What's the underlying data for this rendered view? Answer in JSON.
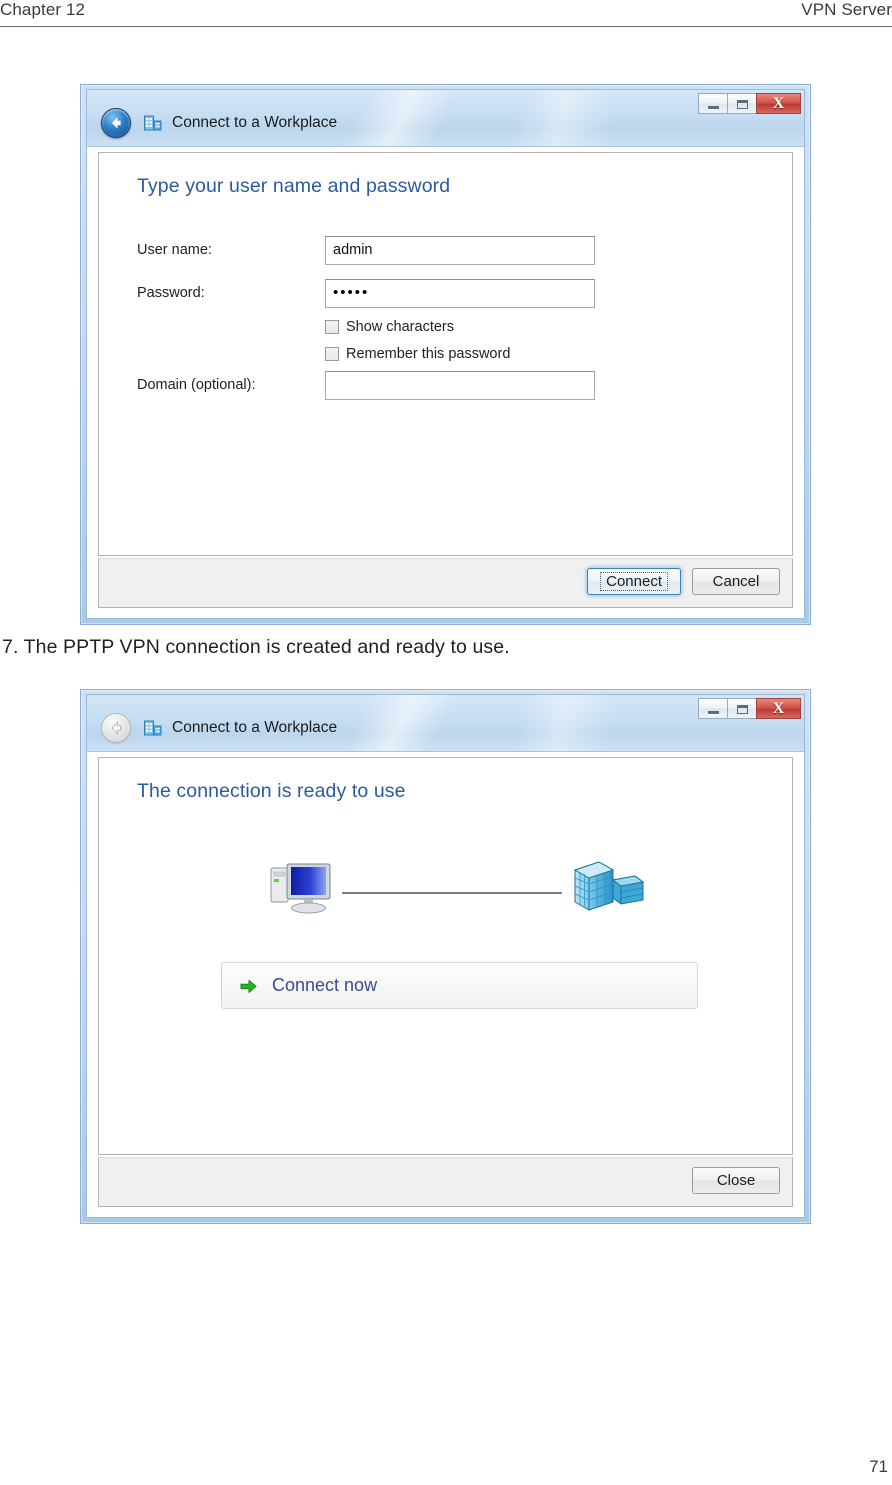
{
  "page": {
    "header_left": "Chapter 12",
    "header_right": "VPN Server",
    "number": "71",
    "body_text": "7. The PPTP VPN connection is created and ready to use."
  },
  "colors": {
    "heading_blue": "#2c5aa0",
    "link_blue": "#3b4a8f",
    "close_red": "#c2392e",
    "arrow_green": "#22b822",
    "frame_blue": "#bfd8ef"
  },
  "dialog1": {
    "title": "Connect to a Workplace",
    "icon": "workplace-icon",
    "back_button_enabled": true,
    "caption": {
      "minimize": "Minimize",
      "maximize": "Maximize",
      "close": "Close",
      "close_glyph": "X"
    },
    "heading": "Type your user name and password",
    "fields": [
      {
        "label": "User name:",
        "value": "admin",
        "masked": false,
        "placeholder": ""
      },
      {
        "label": "Password:",
        "value": "•••••",
        "masked": true,
        "placeholder": ""
      },
      {
        "label": "Domain (optional):",
        "value": "",
        "masked": false,
        "placeholder": ""
      }
    ],
    "checkboxes": [
      {
        "label": "Show characters",
        "checked": false
      },
      {
        "label": "Remember this password",
        "checked": false
      }
    ],
    "buttons": [
      {
        "label": "Connect",
        "default": true
      },
      {
        "label": "Cancel",
        "default": false
      }
    ]
  },
  "dialog2": {
    "title": "Connect to a Workplace",
    "icon": "workplace-icon",
    "back_button_enabled": false,
    "caption": {
      "minimize": "Minimize",
      "maximize": "Maximize",
      "close": "Close",
      "close_glyph": "X"
    },
    "heading": "The connection is ready to use",
    "graphic": {
      "left_icon": "computer-icon",
      "right_icon": "server-icon",
      "connector": "connection-line"
    },
    "action": {
      "label": "Connect now",
      "icon": "green-arrow-icon"
    },
    "ghost_text": "",
    "buttons": [
      {
        "label": "Close",
        "default": false
      }
    ]
  }
}
